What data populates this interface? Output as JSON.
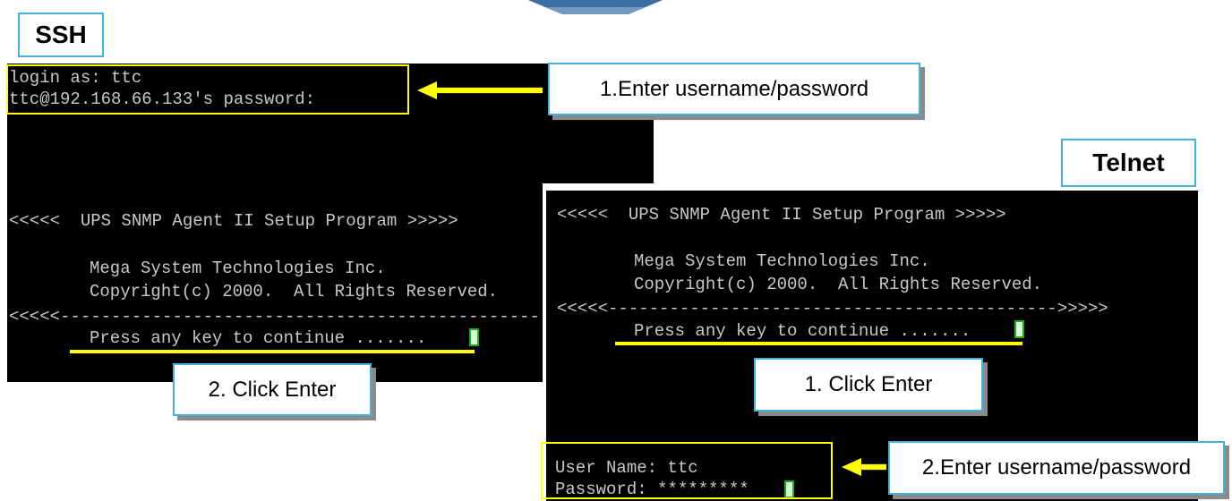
{
  "labels": {
    "ssh_title": "SSH",
    "telnet_title": "Telnet",
    "ssh_step1": "1.Enter username/password",
    "ssh_step2": "2. Click Enter",
    "telnet_step1": "1. Click Enter",
    "telnet_step2": "2.Enter username/password"
  },
  "ssh_terminal": {
    "login_line": "login as: ttc",
    "password_line": "ttc@192.168.66.133's password:",
    "banner": "<<<<<  UPS SNMP Agent II Setup Program >>>>>",
    "company": "Mega System Technologies Inc.",
    "copyright": "Copyright(c) 2000.  All Rights Reserved.",
    "divider": "<<<<<------------------------------------------------",
    "press_key": "Press any key to continue ......."
  },
  "telnet_terminal": {
    "banner": "<<<<<  UPS SNMP Agent II Setup Program >>>>>",
    "company": "Mega System Technologies Inc.",
    "copyright": "Copyright(c) 2000.  All Rights Reserved.",
    "divider": "<<<<<-------------------------------------------->>>>>",
    "press_key": "Press any key to continue .......",
    "user_name": "User Name: ttc",
    "password": "Password: *********"
  },
  "colors": {
    "highlight": "#ffff00",
    "box_border": "#45b0e0",
    "terminal_bg": "#000000",
    "terminal_text": "#c8c8c8"
  }
}
